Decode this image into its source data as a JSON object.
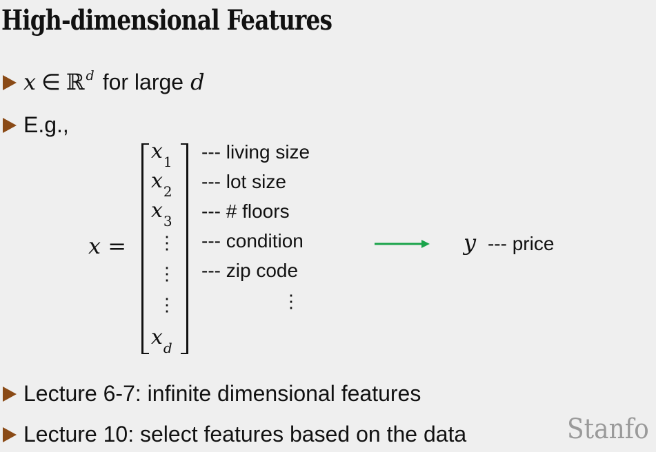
{
  "slide": {
    "title": "High-dimensional Features",
    "bullet1": {
      "x": "x",
      "in": "∈",
      "R": "ℝ",
      "d_sup": "d",
      "text": "for large",
      "d": "d"
    },
    "bullet2": {
      "text": "E.g.,"
    },
    "matrix": {
      "lhs": "x =",
      "entries": [
        {
          "var": "x",
          "sub": "1"
        },
        {
          "var": "x",
          "sub": "2"
        },
        {
          "var": "x",
          "sub": "3"
        },
        {
          "var": "x",
          "sub": "d"
        }
      ],
      "vdots": "⋮"
    },
    "features": [
      "--- living size",
      "--- lot size",
      "--- # floors",
      "--- condition",
      "--- zip code"
    ],
    "target": {
      "var": "y",
      "label": "--- price"
    },
    "bullet3": {
      "text": "Lecture 6-7: infinite dimensional features"
    },
    "bullet4": {
      "text": "Lecture 10: select features based on the data"
    },
    "watermark": "Stanfo"
  },
  "colors": {
    "bullet_arrow": "#8a4a16",
    "green_arrow": "#1aa34a",
    "watermark": "#9a9a9a"
  }
}
